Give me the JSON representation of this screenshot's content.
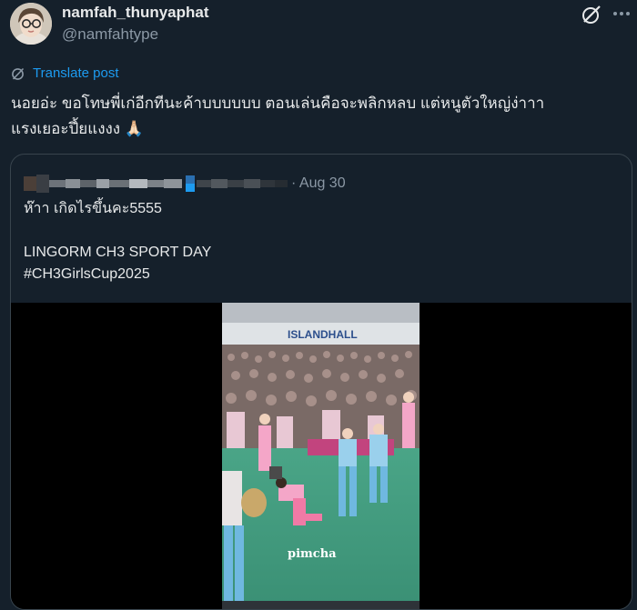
{
  "author": {
    "name": "namfah_thunyaphat",
    "handle": "@namfahtype"
  },
  "icons": {
    "grok": "grok-icon",
    "more": "more-icon",
    "translate": "translate-icon"
  },
  "translate_label": "Translate post",
  "post": {
    "line1": "นอยอ่ะ ขอโทษพี่เก่อีกทีนะค้าบบบบบบ ตอนเล่นคือจะพลิกหลบ แต่หนูตัวใหญ่ง่าาา",
    "line2": "แรงเยอะปึ้ยแงงง",
    "emoji": "🙏🏻"
  },
  "quote": {
    "date": "· Aug 30",
    "lines": [
      "ห๊าา เกิดไรขึ้นคะ5555",
      "",
      "LINGORM CH3 SPORT DAY",
      "#CH3GirlsCup2025"
    ],
    "video": {
      "banner": "ISLANDHALL",
      "watermark": "pimcha"
    }
  },
  "colors": {
    "background": "#15202b",
    "accent": "#1d9bf0",
    "muted": "#8b98a5",
    "border": "#38444d"
  }
}
